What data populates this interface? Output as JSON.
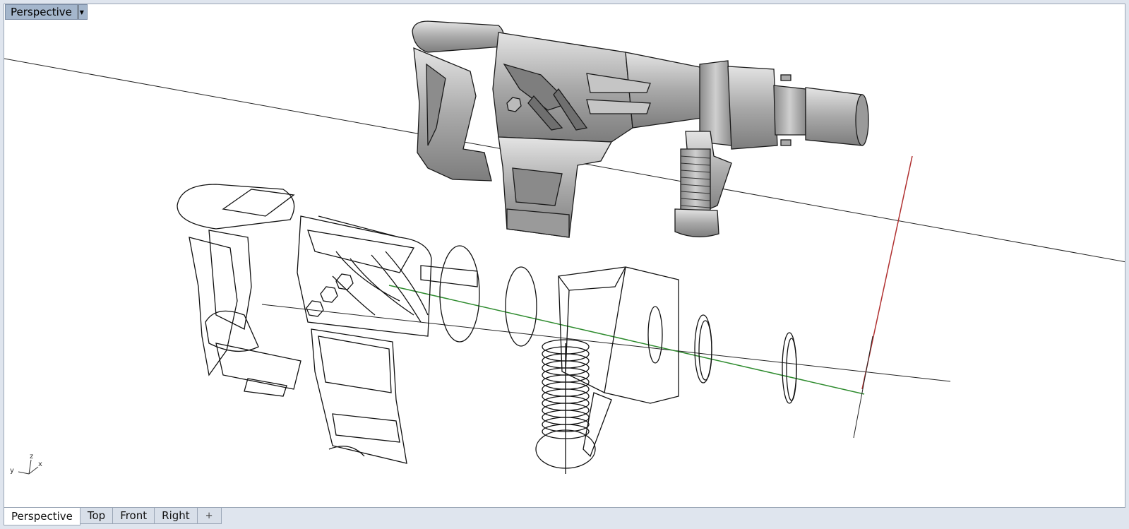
{
  "viewport": {
    "label": "Perspective",
    "caret_icon": "caret-down-icon"
  },
  "axis": {
    "x": "x",
    "y": "y",
    "z": "z"
  },
  "tabs": [
    {
      "label": "Perspective",
      "active": true
    },
    {
      "label": "Top",
      "active": false
    },
    {
      "label": "Front",
      "active": false
    },
    {
      "label": "Right",
      "active": false
    }
  ],
  "add_tab": {
    "label": "+",
    "icon": "plus-icon"
  },
  "colors": {
    "background": "#dfe5ee",
    "viewport_bg": "#ffffff",
    "label_bg": "#a4b6cc",
    "x_axis": "#b03030",
    "y_axis": "#2e8b2e",
    "wire": "#111111",
    "shaded": "#a8a8a8"
  }
}
